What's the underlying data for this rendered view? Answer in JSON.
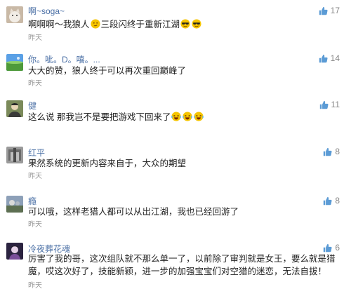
{
  "comments": [
    {
      "username": "啊~soga~",
      "text_before": "啊啊啊～我狼人",
      "text_mid": "三段闪终于重新江湖",
      "time": "昨天",
      "likes": "17"
    },
    {
      "username": "你。呲。D。嘻。...",
      "text": "大大的赞，狼人终于可以再次重回巅峰了",
      "time": "昨天",
      "likes": "14"
    },
    {
      "username": "健",
      "text": "这么说 那我岂不是要把游戏下回来了",
      "time": "昨天",
      "likes": "11"
    },
    {
      "username": "红平",
      "text": "果然系统的更新内容来自于，大众的期望",
      "time": "昨天",
      "likes": "8"
    },
    {
      "username": "瘾",
      "text": "可以哦，这样老猎人都可以从出江湖，我也已经回游了",
      "time": "昨天",
      "likes": "8"
    },
    {
      "username": "冷夜葬花魂",
      "text": "厉害了我的哥，这次组队就不那么单一了，以前除了审判就是女王，要么就是猎魔，哎这次好了，技能新颖，进一步的加强宝宝们对空猎的迷恋，无法自拔！",
      "time": "昨天",
      "likes": "6"
    }
  ],
  "icons": {
    "like": "thumbs-up-icon",
    "emoji_smirk": "smirk-emoji",
    "emoji_cool": "sunglasses-emoji",
    "emoji_laugh": "tears-of-joy-emoji"
  },
  "colors": {
    "username": "#4a6fa5",
    "like": "#5b9bd5",
    "meta": "#999999"
  }
}
